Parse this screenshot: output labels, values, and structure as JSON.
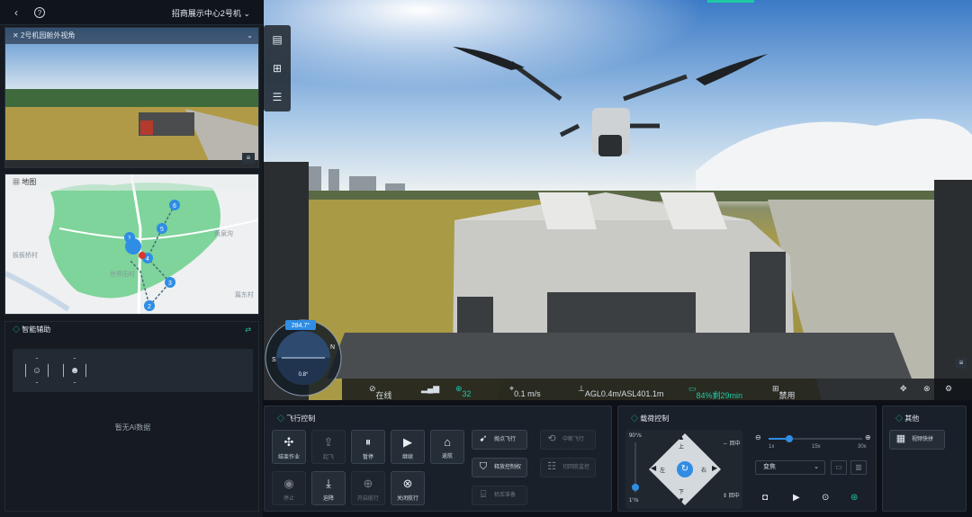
{
  "topbar": {
    "back_icon": "chevron-left-icon",
    "help_icon": "help-icon",
    "device_title": "招商展示中心2号机"
  },
  "camera_panel": {
    "title": "2号机园舱外视角"
  },
  "map_panel": {
    "title": "地图",
    "labels": [
      "黄泉沟",
      "板板桥村",
      "世界田村",
      "篇东村"
    ],
    "waypoints": [
      "1",
      "2",
      "3",
      "4",
      "5",
      "6"
    ]
  },
  "assist_panel": {
    "title": "智能辅助",
    "empty_text": "暂无AI数据"
  },
  "compass": {
    "heading": "284.7°",
    "pitch": "0.8°",
    "letters": [
      "W",
      "N",
      "E",
      "S"
    ]
  },
  "status": {
    "link": "在线",
    "satellites": "32",
    "speed": "0.1 m/s",
    "altitude": "AGL0.4m/ASL401.1m",
    "battery": "84%剩29min",
    "mode": "禁用"
  },
  "flight": {
    "title": "飞行控制",
    "buttons": [
      "结束作业",
      "起飞",
      "暂停",
      "继续",
      "返航",
      "停止",
      "迫降",
      "开启航行",
      "关闭航行"
    ],
    "side_buttons": [
      "抛点飞行",
      "中断飞行",
      "释放控制权",
      "切回航监控",
      "机库准备"
    ]
  },
  "gimbal": {
    "title": "载荷控制",
    "speed_top": "90°/s",
    "speed_bottom": "1°/s",
    "dirs": {
      "up": "上",
      "down": "下",
      "left": "左",
      "right": "右"
    },
    "reset_top": "回中",
    "reset_bottom": "回中",
    "zoom_min": "1x",
    "zoom_mid": "15x",
    "zoom_max": "30x",
    "zoom_level": 0.22,
    "lens_select": "变焦"
  },
  "other": {
    "title": "其他",
    "snapshot": "视频快拼"
  },
  "colors": {
    "accent": "#1ec8a5",
    "blue": "#2f8de4",
    "panel": "#1a2029"
  }
}
